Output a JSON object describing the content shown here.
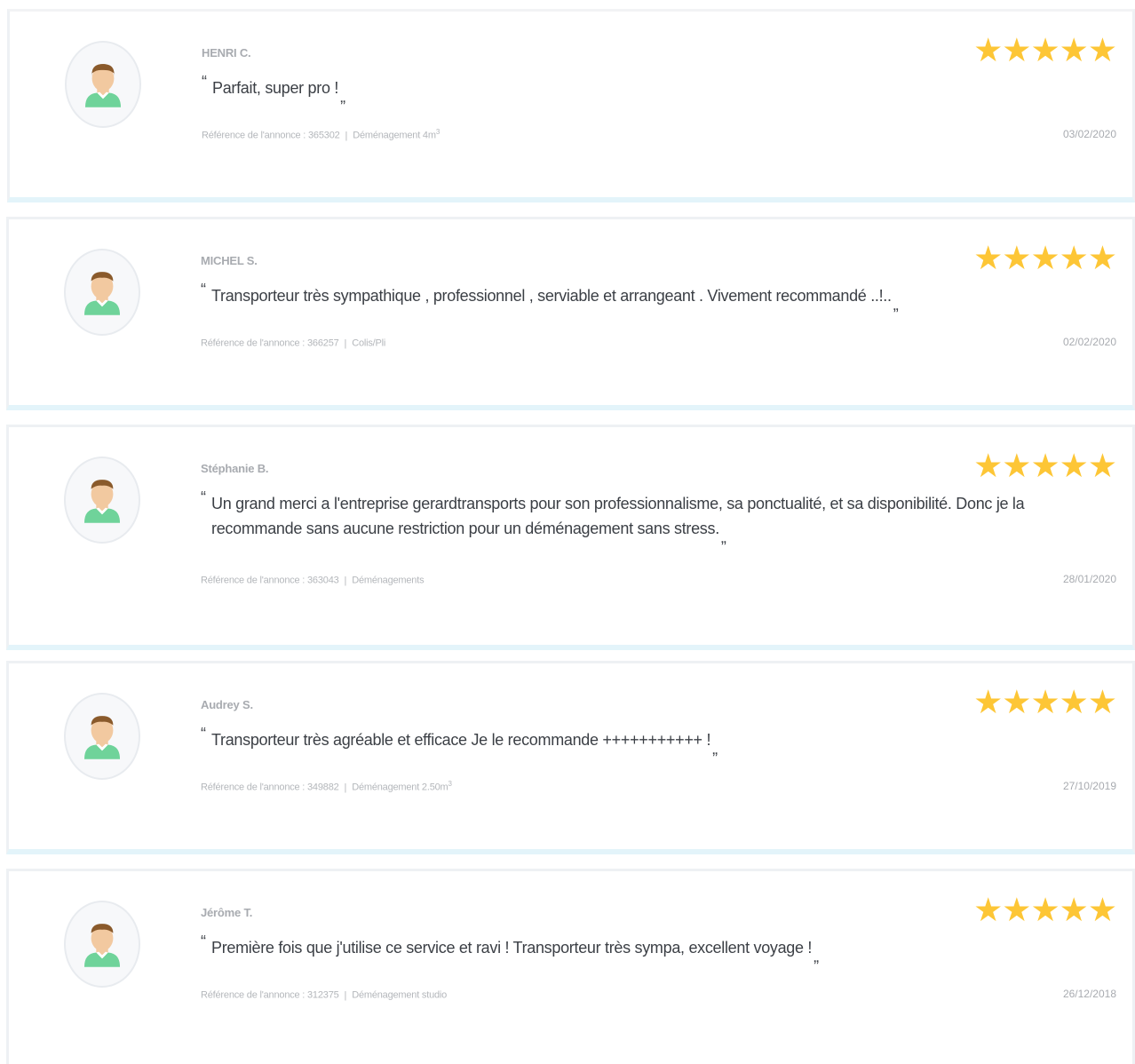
{
  "reviews": [
    {
      "name": "HENRI C.",
      "comment": "Parfait, super pro !",
      "reference_label": "Référence de l'annonce : 365302",
      "category": "Déménagement 4m",
      "category_sup": "3",
      "stars": "★★★★★",
      "date": "03/02/2020"
    },
    {
      "name": "MICHEL S.",
      "comment": "Transporteur très sympathique , professionnel , serviable et arrangeant . Vivement recommandé ..!..",
      "reference_label": "Référence de l'annonce : 366257",
      "category": "Colis/Pli",
      "category_sup": "",
      "stars": "★★★★★",
      "date": "02/02/2020"
    },
    {
      "name": "Stéphanie B.",
      "comment": "Un grand merci a l'entreprise gerardtransports pour son professionnalisme, sa ponctualité, et sa disponibilité. Donc je la recommande sans aucune restriction pour un déménagement sans stress.",
      "reference_label": "Référence de l'annonce : 363043",
      "category": "Déménagements",
      "category_sup": "",
      "stars": "★★★★★",
      "date": "28/01/2020"
    },
    {
      "name": "Audrey S.",
      "comment": "Transporteur très agréable et efficace Je le recommande +++++++++++ !",
      "reference_label": "Référence de l'annonce : 349882",
      "category": "Déménagement 2.50m",
      "category_sup": "3",
      "stars": "★★★★★",
      "date": "27/10/2019"
    },
    {
      "name": "Jérôme T.",
      "comment": "Première fois que j'utilise ce service et ravi ! Transporteur très sympa, excellent voyage !",
      "reference_label": "Référence de l'annonce : 312375",
      "category": "Déménagement studio",
      "category_sup": "",
      "stars": "★★★★★",
      "date": "26/12/2018"
    }
  ],
  "quote_open": "“",
  "quote_close": "„",
  "separator": "|",
  "colors": {
    "star": "#fdc636",
    "name": "#a8abb0",
    "comment": "#3b3f45",
    "meta": "#b4b7bb",
    "card_border": "#eef1f4",
    "card_accent": "#e3f4fa",
    "avatar_shirt": "#6fd39a",
    "avatar_skin": "#f2c9a0",
    "avatar_hair": "#8a5a2b"
  }
}
